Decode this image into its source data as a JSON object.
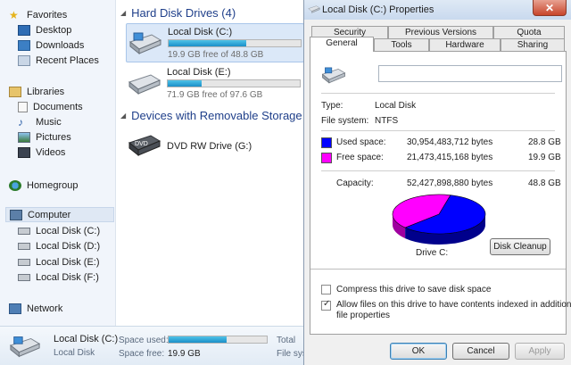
{
  "nav": {
    "favorites": "Favorites",
    "desktop": "Desktop",
    "downloads": "Downloads",
    "recent": "Recent Places",
    "libraries": "Libraries",
    "documents": "Documents",
    "music": "Music",
    "pictures": "Pictures",
    "videos": "Videos",
    "homegroup": "Homegroup",
    "computer": "Computer",
    "disk_c": "Local Disk (C:)",
    "disk_d": "Local Disk (D:)",
    "disk_e": "Local Disk (E:)",
    "disk_f": "Local Disk (F:)",
    "network": "Network"
  },
  "content": {
    "hdd_header": "Hard Disk Drives (4)",
    "removable_header": "Devices with Removable Storage (",
    "drives": [
      {
        "name": "Local Disk (C:)",
        "free": "19.9 GB free of 48.8 GB",
        "used_fraction": 0.59
      },
      {
        "name": "Local Disk (E:)",
        "free": "71.9 GB free of 97.6 GB",
        "used_fraction": 0.26
      }
    ],
    "dvd": {
      "name": "DVD RW Drive (G:)",
      "icon_label": "DVD"
    }
  },
  "details": {
    "name": "Local Disk (C:)",
    "type": "Local Disk",
    "space_used_label": "Space used:",
    "space_free_label": "Space free:",
    "space_free": "19.9 GB",
    "total_label": "Total",
    "filesys_label": "File syst",
    "used_fraction": 0.59
  },
  "dialog": {
    "title": "Local Disk (C:) Properties",
    "close": "✕",
    "tabs_back": [
      "Security",
      "Previous Versions",
      "Quota"
    ],
    "tabs_front": [
      "General",
      "Tools",
      "Hardware",
      "Sharing"
    ],
    "type_label": "Type:",
    "type_value": "Local Disk",
    "fs_label": "File system:",
    "fs_value": "NTFS",
    "used_label": "Used space:",
    "used_bytes": "30,954,483,712 bytes",
    "used_gb": "28.8 GB",
    "free_label": "Free space:",
    "free_bytes": "21,473,415,168 bytes",
    "free_gb": "19.9 GB",
    "capacity_label": "Capacity:",
    "capacity_bytes": "52,427,898,880 bytes",
    "capacity_gb": "48.8 GB",
    "drive_label": "Drive C:",
    "cleanup": "Disk Cleanup",
    "compress": "Compress this drive to save disk space",
    "index_line1": "Allow files on this drive to have contents indexed in addition to",
    "index_line2": "file properties",
    "ok": "OK",
    "cancel": "Cancel",
    "apply": "Apply",
    "colors": {
      "used": "#0000ff",
      "free": "#ff00ff"
    }
  }
}
